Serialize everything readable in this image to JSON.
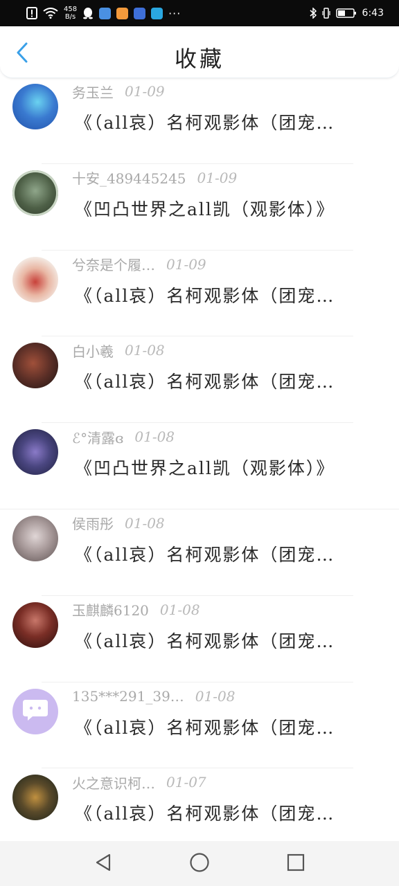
{
  "status_bar": {
    "net_speed_value": "458",
    "net_speed_unit": "B/s",
    "more": "···",
    "time": "6:43",
    "icons": [
      "alert-icon",
      "wifi-icon",
      "qq-icon",
      "app-badges",
      "bluetooth-icon",
      "vibrate-icon",
      "battery-icon"
    ],
    "app_badge_colors": [
      "#4a90e2",
      "#f39a3c",
      "#3e6fd8",
      "#2aa7e0"
    ]
  },
  "header": {
    "title": "收藏",
    "back_icon": "chevron-left-icon",
    "accent": "#3aa0e8"
  },
  "favorites": [
    {
      "user": "务玉兰",
      "date": "01-09",
      "title": "《（all哀）名柯观影体（团宠…",
      "avatar_colors": [
        "#1f4fa8",
        "#6ad2f0"
      ]
    },
    {
      "user": "十安_489445245",
      "date": "01-09",
      "title": "《凹凸世界之all凯（观影体）》",
      "avatar_colors": [
        "#3b4a34",
        "#8fa68a"
      ]
    },
    {
      "user": "兮奈是个履…",
      "date": "01-09",
      "title": "《（all哀）名柯观影体（团宠…",
      "avatar_colors": [
        "#f2e6de",
        "#c8413a"
      ]
    },
    {
      "user": "白小羲",
      "date": "01-08",
      "title": "《（all哀）名柯观影体（团宠…",
      "avatar_colors": [
        "#3a2220",
        "#a0503a"
      ]
    },
    {
      "user": "ℰ°清露ɞ",
      "date": "01-08",
      "title": "《凹凸世界之all凯（观影体）》",
      "avatar_colors": [
        "#2a2c52",
        "#8a7ac8"
      ]
    },
    {
      "user": "侯雨彤",
      "date": "01-08",
      "title": "《（all哀）名柯观影体（团宠…",
      "avatar_colors": [
        "#7a6a6a",
        "#e0d6d6"
      ]
    },
    {
      "user": "玉麒麟6120",
      "date": "01-08",
      "title": "《（all哀）名柯观影体（团宠…",
      "avatar_colors": [
        "#3a1410",
        "#9a4a40"
      ]
    },
    {
      "user": "135***291_39…",
      "date": "01-08",
      "title": "《（all哀）名柯观影体（团宠…",
      "avatar_colors": [
        "#c7b6ee",
        "#c7b6ee"
      ]
    },
    {
      "user": "火之意识柯…",
      "date": "01-07",
      "title": "《（all哀）名柯观影体（团宠…",
      "avatar_colors": [
        "#2a3a2a",
        "#c09040"
      ]
    }
  ],
  "nav": {
    "back": "triangle-back-icon",
    "home": "circle-home-icon",
    "recents": "square-recents-icon"
  }
}
